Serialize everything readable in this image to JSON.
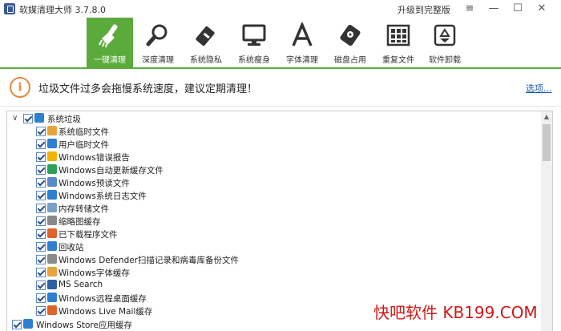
{
  "app": {
    "title": "软媒清理大师 3.7.8.0",
    "upgrade": "升级到完整版"
  },
  "window_controls": {
    "menu": "≡",
    "minimize": "—",
    "maximize": "☐",
    "close": "✕"
  },
  "toolbar": {
    "accent": "#5bab3c",
    "items": [
      {
        "label": "一键清理",
        "icon": "broom-icon",
        "active": true
      },
      {
        "label": "深度清理",
        "icon": "magnifier-icon"
      },
      {
        "label": "系统隐私",
        "icon": "eraser-icon"
      },
      {
        "label": "系统瘦身",
        "icon": "monitor-icon"
      },
      {
        "label": "字体清理",
        "icon": "font-a-icon"
      },
      {
        "label": "磁盘占用",
        "icon": "disk-icon"
      },
      {
        "label": "重复文件",
        "icon": "duplicate-grid-icon"
      },
      {
        "label": "软件卸载",
        "icon": "recycle-icon"
      }
    ]
  },
  "banner": {
    "icon": "info-icon",
    "text": "垃圾文件过多会拖慢系统速度，建议定期清理！",
    "options": "选项..."
  },
  "tree": {
    "root": {
      "label": "系统垃圾",
      "icon": "windows-logo-icon",
      "checked": true
    },
    "items": [
      {
        "label": "系统临时文件",
        "icon": "windows-flag-icon",
        "color": "#e8a33a"
      },
      {
        "label": "用户临时文件",
        "icon": "user-folder-icon",
        "color": "#2f7fd1"
      },
      {
        "label": "Windows错误报告",
        "icon": "error-report-icon",
        "color": "#f0b400"
      },
      {
        "label": "Windows自动更新缓存文件",
        "icon": "update-globe-icon",
        "color": "#2aa05a"
      },
      {
        "label": "Windows预读文件",
        "icon": "prefetch-icon",
        "color": "#5a8ac6"
      },
      {
        "label": "Windows系统日志文件",
        "icon": "log-file-icon",
        "color": "#2f7fd1"
      },
      {
        "label": "内存转储文件",
        "icon": "memory-dump-icon",
        "color": "#7aa0c8"
      },
      {
        "label": "缩略图缓存",
        "icon": "thumbnail-icon",
        "color": "#888888"
      },
      {
        "label": "已下载程序文件",
        "icon": "download-icon",
        "color": "#e0622a"
      },
      {
        "label": "回收站",
        "icon": "recycle-bin-icon",
        "color": "#2f7fd1"
      },
      {
        "label": "Windows Defender扫描记录和病毒库备份文件",
        "icon": "defender-icon",
        "color": "#8a8a8a"
      },
      {
        "label": "Windows字体缓存",
        "icon": "font-cache-icon",
        "color": "#e8a33a"
      },
      {
        "label": "MS Search",
        "icon": "search-icon",
        "color": "#2f5fa0"
      },
      {
        "label": "Windows远程桌面缓存",
        "icon": "remote-desktop-icon",
        "color": "#2f7fd1"
      },
      {
        "label": "Windows Live Mail缓存",
        "icon": "live-mail-icon",
        "color": "#e0622a"
      }
    ],
    "next_root": {
      "label": "Windows Store应用缓存",
      "icon": "windows-logo-icon"
    }
  },
  "watermark": "快吧软件 KB199.COM"
}
